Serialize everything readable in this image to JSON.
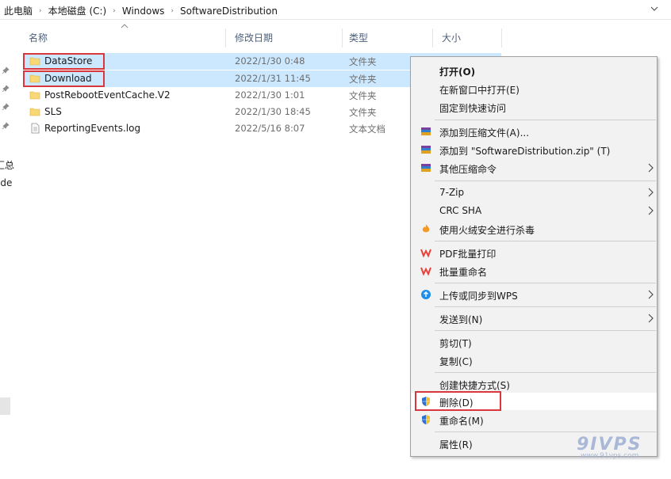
{
  "breadcrumb": {
    "items": [
      "此电脑",
      "本地磁盘 (C:)",
      "Windows",
      "SoftwareDistribution"
    ]
  },
  "nav": {
    "fragment_1": "汇总",
    "fragment_2": "ide"
  },
  "columns": {
    "name": "名称",
    "date": "修改日期",
    "type": "类型",
    "size": "大小"
  },
  "files": [
    {
      "name": "DataStore",
      "date": "2022/1/30 0:48",
      "type": "文件夹",
      "icon": "folder-icon",
      "selected": true
    },
    {
      "name": "Download",
      "date": "2022/1/31 11:45",
      "type": "文件夹",
      "icon": "folder-icon",
      "selected": true
    },
    {
      "name": "PostRebootEventCache.V2",
      "date": "2022/1/30 1:01",
      "type": "文件夹",
      "icon": "folder-icon",
      "selected": false
    },
    {
      "name": "SLS",
      "date": "2022/1/30 18:45",
      "type": "文件夹",
      "icon": "folder-icon",
      "selected": false
    },
    {
      "name": "ReportingEvents.log",
      "date": "2022/5/16 8:07",
      "type": "文本文档",
      "icon": "text-file-icon",
      "selected": false
    }
  ],
  "menu": {
    "open": "打开(O)",
    "open_new_window": "在新窗口中打开(E)",
    "pin_quick_access": "固定到快速访问",
    "add_archive": "添加到压缩文件(A)...",
    "add_zip": "添加到 \"SoftwareDistribution.zip\" (T)",
    "more_compress": "其他压缩命令",
    "sevenzip": "7-Zip",
    "crc_sha": "CRC SHA",
    "huorong_scan": "使用火绒安全进行杀毒",
    "pdf_print": "PDF批量打印",
    "batch_rename": "批量重命名",
    "wps_sync": "上传或同步到WPS",
    "send_to": "发送到(N)",
    "cut": "剪切(T)",
    "copy": "复制(C)",
    "create_shortcut": "创建快捷方式(S)",
    "delete": "删除(D)",
    "rename": "重命名(M)",
    "properties": "属性(R)"
  },
  "watermark": {
    "brand": "9IVPS",
    "url": "www.91vps.com"
  },
  "colors": {
    "selection": "#cce8ff",
    "highlight_box": "#d9363e",
    "menu_bg": "#f2f2f2",
    "header_text": "#4c607a",
    "folder": "#f8d775",
    "wps_red": "#e8413c",
    "huorong_orange": "#f59a23",
    "wps_cloud": "#1d8fe8"
  }
}
